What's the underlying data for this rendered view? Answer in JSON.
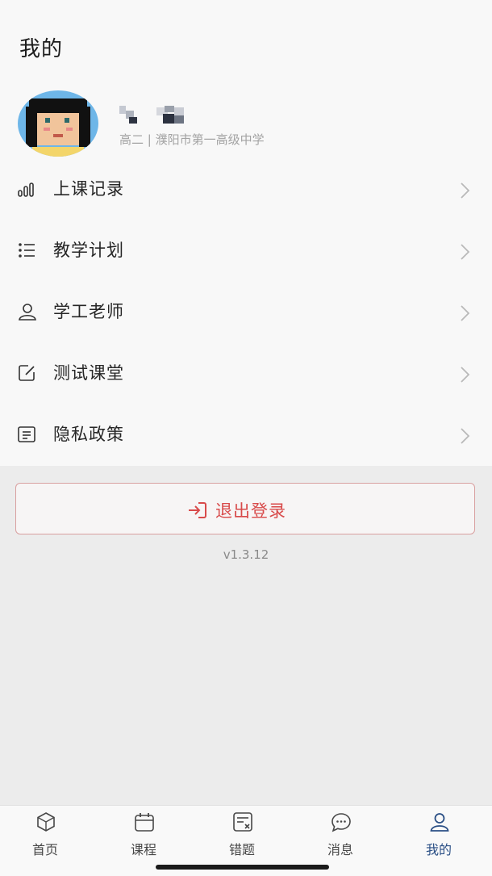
{
  "header": {
    "title": "我的"
  },
  "profile": {
    "name_label": "已隐藏用户名",
    "subtitle": "高二 | 濮阳市第一高级中学",
    "avatar_icon": "pixel-avatar"
  },
  "menu": [
    {
      "label": "上课记录",
      "icon": "bar-chart-icon"
    },
    {
      "label": "教学计划",
      "icon": "list-icon"
    },
    {
      "label": "学工老师",
      "icon": "user-icon"
    },
    {
      "label": "测试课堂",
      "icon": "edit-icon"
    },
    {
      "label": "隐私政策",
      "icon": "document-icon"
    }
  ],
  "logout": {
    "label": "退出登录",
    "icon": "logout-icon",
    "color": "#d84a4a"
  },
  "version": "v1.3.12",
  "tabs": [
    {
      "label": "首页",
      "icon": "cube-icon",
      "active": false
    },
    {
      "label": "课程",
      "icon": "calendar-icon",
      "active": false
    },
    {
      "label": "错题",
      "icon": "mistake-book-icon",
      "active": false
    },
    {
      "label": "消息",
      "icon": "chat-bubble-icon",
      "active": false
    },
    {
      "label": "我的",
      "icon": "user-icon",
      "active": true
    }
  ],
  "colors": {
    "accent": "#2a4f85",
    "danger": "#d84a4a"
  }
}
